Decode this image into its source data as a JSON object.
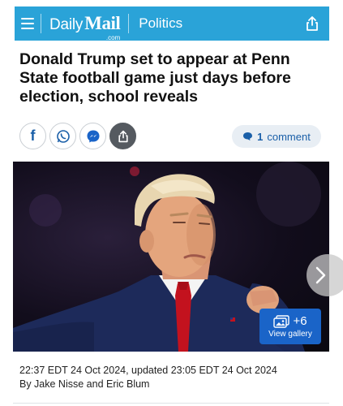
{
  "header": {
    "logo_daily": "Daily",
    "logo_mail": "Mail",
    "logo_dotcom": ".com",
    "section": "Politics",
    "bg_color": "#2aa3d8"
  },
  "article": {
    "headline": "Donald Trump set to appear at Penn State football game just days before election, school reveals",
    "timestamp": "22:37 EDT 24 Oct 2024, updated 23:05 EDT 24 Oct 2024",
    "byline": "By Jake Nisse and Eric Blum"
  },
  "share": {
    "icons": [
      "facebook-icon",
      "whatsapp-icon",
      "messenger-icon",
      "share-icon"
    ],
    "facebook_glyph": "f"
  },
  "comments": {
    "count": "1",
    "label": "comment"
  },
  "gallery": {
    "count": "+6",
    "label": "View gallery"
  },
  "colors": {
    "link_blue": "#1a5fa8",
    "gallery_blue": "#1a64c8"
  }
}
